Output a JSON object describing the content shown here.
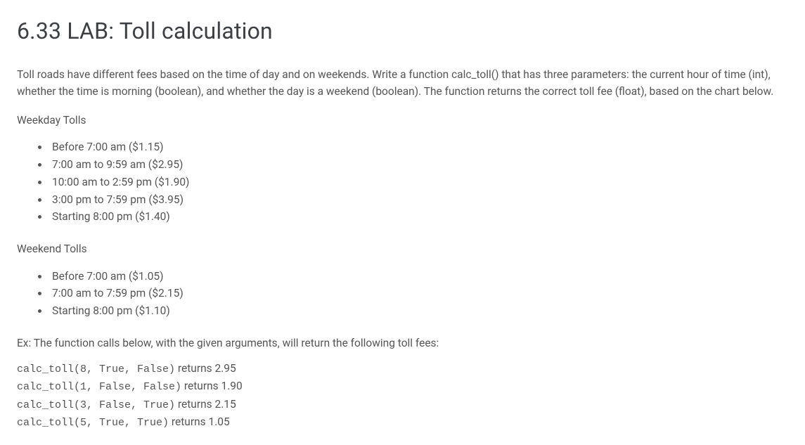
{
  "title": "6.33 LAB: Toll calculation",
  "description": "Toll roads have different fees based on the time of day and on weekends. Write a function calc_toll() that has three parameters: the current hour of time (int), whether the time is morning (boolean), and whether the day is a weekend (boolean). The function returns the correct toll fee (float), based on the chart below.",
  "weekday": {
    "label": "Weekday Tolls",
    "items": [
      "Before 7:00 am ($1.15)",
      "7:00 am to 9:59 am ($2.95)",
      "10:00 am to 2:59 pm ($1.90)",
      "3:00 pm to 7:59 pm ($3.95)",
      "Starting 8:00 pm ($1.40)"
    ]
  },
  "weekend": {
    "label": "Weekend Tolls",
    "items": [
      "Before 7:00 am ($1.05)",
      "7:00 am to 7:59 pm ($2.15)",
      "Starting 8:00 pm ($1.10)"
    ]
  },
  "example": {
    "intro": "Ex: The function calls below, with the given arguments, will return the following toll fees:",
    "lines": [
      {
        "code": "calc_toll(8, True, False)",
        "ret": " returns 2.95"
      },
      {
        "code": "calc_toll(1, False, False)",
        "ret": " returns 1.90"
      },
      {
        "code": "calc_toll(3, False, True)",
        "ret": " returns 2.15"
      },
      {
        "code": "calc_toll(5, True, True)",
        "ret": " returns 1.05"
      }
    ]
  }
}
